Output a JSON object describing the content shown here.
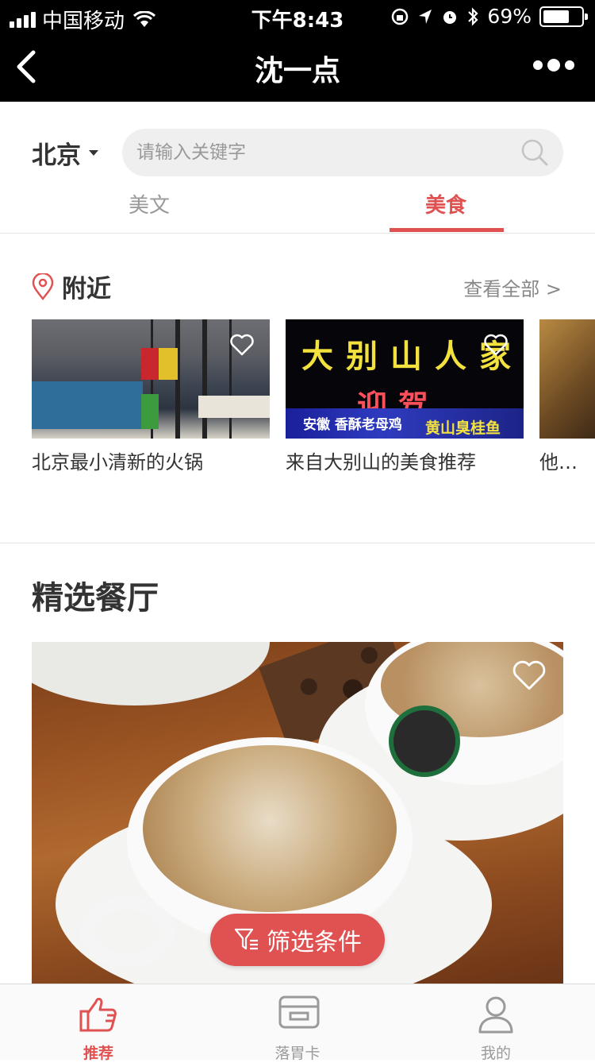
{
  "status_bar": {
    "carrier": "中国移动",
    "time": "下午8:43",
    "battery": "69%",
    "battery_level": 0.69
  },
  "nav": {
    "title": "沈一点"
  },
  "search": {
    "city": "北京",
    "placeholder": "请输入关键字"
  },
  "tabs": [
    {
      "label": "美文",
      "active": false
    },
    {
      "label": "美食",
      "active": true
    }
  ],
  "nearby": {
    "title": "附近",
    "view_all": "查看全部 >",
    "cards": [
      {
        "caption": "北京最小清新的火锅",
        "favorited": false
      },
      {
        "caption": "来自大别山的美食推荐",
        "favorited": false,
        "sign_text": "大别山人家",
        "sign_text2": "迎驾",
        "sign_small": "安徽 香酥老母鸡",
        "sign_small2": "黄山臭桂鱼"
      },
      {
        "caption": "他…",
        "favorited": false
      }
    ]
  },
  "featured": {
    "title": "精选餐厅",
    "favorited": false
  },
  "filter_button": {
    "label": "筛选条件"
  },
  "tab_bar": {
    "items": [
      {
        "label": "推荐",
        "icon": "thumbs-up-icon",
        "active": true
      },
      {
        "label": "落胃卡",
        "icon": "card-icon",
        "active": false
      },
      {
        "label": "我的",
        "icon": "user-icon",
        "active": false
      }
    ]
  },
  "colors": {
    "accent": "#e05252",
    "nav_bg": "#000000",
    "text": "#333333",
    "muted": "#999999"
  }
}
